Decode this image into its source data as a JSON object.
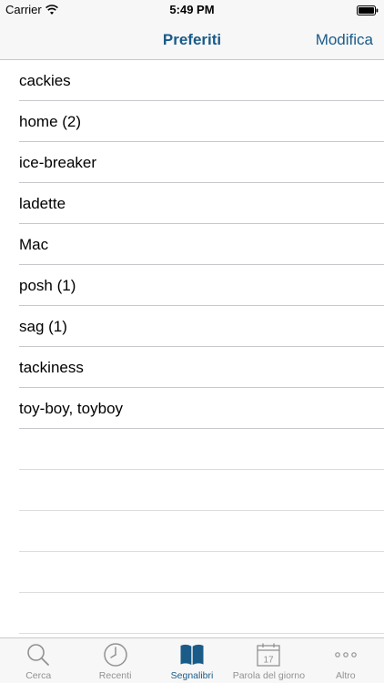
{
  "status_bar": {
    "carrier": "Carrier",
    "time": "5:49 PM"
  },
  "nav": {
    "title": "Preferiti",
    "edit_label": "Modifica"
  },
  "favorites": [
    "cackies",
    "home (2)",
    "ice-breaker",
    "ladette",
    "Mac",
    "posh (1)",
    "sag (1)",
    "tackiness",
    "toy-boy, toyboy"
  ],
  "tabs": [
    {
      "label": "Cerca",
      "icon": "search-icon",
      "active": false
    },
    {
      "label": "Recenti",
      "icon": "clock-icon",
      "active": false
    },
    {
      "label": "Segnalibri",
      "icon": "book-icon",
      "active": true
    },
    {
      "label": "Parola del giorno",
      "icon": "calendar-icon",
      "active": false,
      "calendar_day": "17"
    },
    {
      "label": "Altro",
      "icon": "more-icon",
      "active": false
    }
  ],
  "colors": {
    "accent": "#1a5b88",
    "inactive": "#929292",
    "separator": "#c8c7cc",
    "bar_background": "#f7f7f7"
  }
}
